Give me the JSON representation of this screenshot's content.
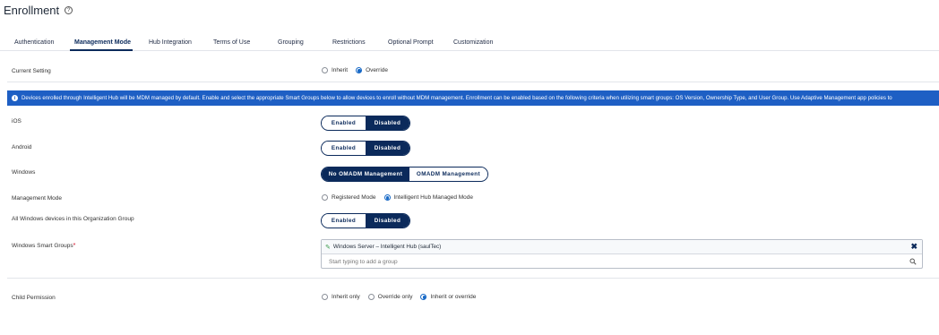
{
  "page": {
    "title": "Enrollment",
    "help_icon": "?"
  },
  "tabs": [
    {
      "label": "Authentication"
    },
    {
      "label": "Management Mode",
      "active": true
    },
    {
      "label": "Hub Integration"
    },
    {
      "label": "Terms of Use"
    },
    {
      "label": "Grouping"
    },
    {
      "label": "Restrictions"
    },
    {
      "label": "Optional Prompt"
    },
    {
      "label": "Customization"
    }
  ],
  "current_setting": {
    "label": "Current Setting",
    "options": [
      "Inherit",
      "Override"
    ],
    "selected": "Override"
  },
  "info_banner": {
    "icon": "i",
    "text": "Devices enrolled through Intelligent Hub will be MDM managed by default. Enable and select the appropriate Smart Groups below to allow devices to enroll without MDM management. Enrollment can be enabled based on the following criteria when utilizing smart groups: OS Version, Ownership Type, and User Group. Use Adaptive Management app policies to"
  },
  "ios": {
    "label": "iOS",
    "options": [
      "Enabled",
      "Disabled"
    ],
    "selected": "Disabled"
  },
  "android": {
    "label": "Android",
    "options": [
      "Enabled",
      "Disabled"
    ],
    "selected": "Disabled"
  },
  "windows": {
    "label": "Windows",
    "options": [
      "No OMADM Management",
      "OMADM Management"
    ],
    "selected": "No OMADM Management"
  },
  "management_mode": {
    "label": "Management Mode",
    "options": [
      "Registered Mode",
      "Intelligent Hub Managed Mode"
    ],
    "selected": "Intelligent Hub Managed Mode"
  },
  "all_windows": {
    "label": "All Windows devices in this Organization Group",
    "options": [
      "Enabled",
      "Disabled"
    ],
    "selected": "Disabled"
  },
  "smart_groups": {
    "label": "Windows Smart Groups",
    "required_mark": "*",
    "selected_group": "Windows Server – Intelligent Hub (saulTec)",
    "remove_icon": "✖",
    "placeholder": "Start typing to add a group"
  },
  "child_permission": {
    "label": "Child Permission",
    "options": [
      "Inherit only",
      "Override only",
      "Inherit or override"
    ],
    "selected": "Inherit or override"
  },
  "colors": {
    "primary_navy": "#0b2a5b",
    "banner_blue": "#1e5fc4",
    "radio_blue": "#1668c6"
  }
}
